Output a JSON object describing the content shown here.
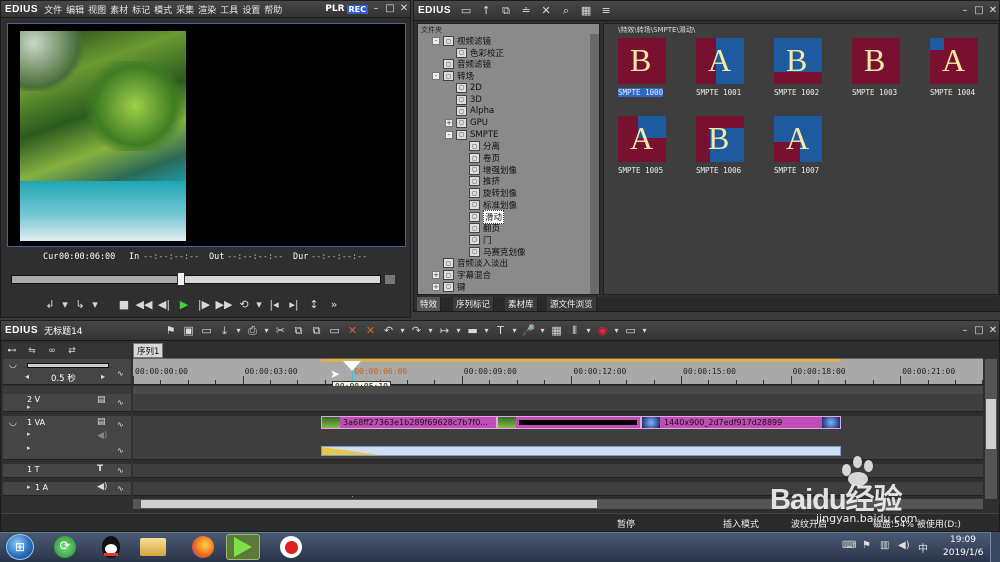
{
  "player": {
    "app": "EDIUS",
    "menu": [
      "文件",
      "编辑",
      "视图",
      "素材",
      "标记",
      "模式",
      "采集",
      "渲染",
      "工具",
      "设置",
      "帮助"
    ],
    "plr": "PLR",
    "rec": "REC",
    "cur_label": "Cur",
    "cur_value": "00:00:06:00",
    "in_label": "In",
    "in_value": "--:--:--:--",
    "out_label": "Out",
    "out_value": "--:--:--:--",
    "dur_label": "Dur",
    "dur_value": "--:--:--:--"
  },
  "bin": {
    "app": "EDIUS",
    "folder_header": "文件夹",
    "path": "\\特效\\转场\\SMPTE\\滑动\\",
    "tree": [
      {
        "label": "视频滤镜",
        "indent": 1,
        "exp": "-"
      },
      {
        "label": "色彩校正",
        "indent": 2,
        "exp": ""
      },
      {
        "label": "音频滤镜",
        "indent": 1,
        "exp": ""
      },
      {
        "label": "转场",
        "indent": 1,
        "exp": "-"
      },
      {
        "label": "2D",
        "indent": 2,
        "exp": ""
      },
      {
        "label": "3D",
        "indent": 2,
        "exp": ""
      },
      {
        "label": "Alpha",
        "indent": 2,
        "exp": ""
      },
      {
        "label": "GPU",
        "indent": 2,
        "exp": "+"
      },
      {
        "label": "SMPTE",
        "indent": 2,
        "exp": "-"
      },
      {
        "label": "分离",
        "indent": 3,
        "exp": ""
      },
      {
        "label": "卷页",
        "indent": 3,
        "exp": ""
      },
      {
        "label": "增强划像",
        "indent": 3,
        "exp": ""
      },
      {
        "label": "推挤",
        "indent": 3,
        "exp": ""
      },
      {
        "label": "旋转划像",
        "indent": 3,
        "exp": ""
      },
      {
        "label": "标准划像",
        "indent": 3,
        "exp": ""
      },
      {
        "label": "滑动",
        "indent": 3,
        "exp": "",
        "selected": true
      },
      {
        "label": "翻页",
        "indent": 3,
        "exp": ""
      },
      {
        "label": "门",
        "indent": 3,
        "exp": ""
      },
      {
        "label": "马赛克划像",
        "indent": 3,
        "exp": ""
      },
      {
        "label": "音频淡入淡出",
        "indent": 1,
        "exp": ""
      },
      {
        "label": "字幕混合",
        "indent": 1,
        "exp": "+"
      },
      {
        "label": "键",
        "indent": 1,
        "exp": "+"
      }
    ],
    "items": [
      "SMPTE 1000",
      "SMPTE 1001",
      "SMPTE 1002",
      "SMPTE 1003",
      "SMPTE 1004",
      "SMPTE 1005",
      "SMPTE 1006",
      "SMPTE 1007"
    ],
    "tabs": [
      "特效",
      "序列标记",
      "素材库",
      "源文件浏览"
    ]
  },
  "timeline": {
    "app": "EDIUS",
    "project": "无标题14",
    "sequence_tab": "序列1",
    "zoom": "0.5 秒",
    "ruler": [
      "00:00:00:00",
      "00:00:03:00",
      "00:00:06:00",
      "00:00:09:00",
      "00:00:12:00",
      "00:00:15:00",
      "00:00:18:00",
      "00:00:21:00"
    ],
    "tooltip": "00:00:05:10",
    "tracks": [
      "2 V",
      "1 VA",
      "1 T",
      "1 A"
    ],
    "clip1": "3a68ff27363e1b289f69628c7b7f0...",
    "clip2": "1440x900_2d7edf917d28899"
  },
  "status": {
    "pause": "暂停",
    "insert": "插入模式",
    "ripple": "波纹开启",
    "disk": "磁盘:54% 被使用(D:)"
  },
  "taskbar": {
    "time": "19:09",
    "date": "2019/1/6"
  },
  "watermark": {
    "brand": "Baidu经验",
    "url": "jingyan.baidu.com"
  },
  "colors": {
    "accent": "#2f67c8",
    "clip": "#c04db5",
    "rec": "#2f5fd0"
  }
}
